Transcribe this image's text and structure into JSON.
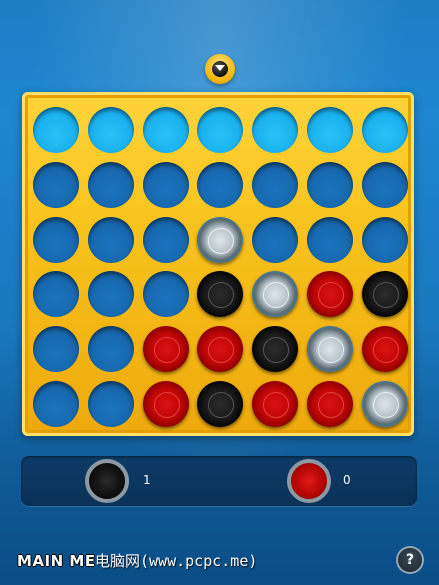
{
  "colors": {
    "background": "#1a78be",
    "board": "#f8c21c",
    "red_chip": "#c20606",
    "black_chip": "#1a1a1a",
    "empty_hole": "#1767ad",
    "score_bar": "#0a3157"
  },
  "drop_indicator": {
    "icon": "chevron-down-icon",
    "column": 4,
    "player": "black"
  },
  "board": {
    "columns": 7,
    "rows": 6,
    "grid": [
      [
        "empty",
        "empty",
        "empty",
        "empty",
        "empty",
        "empty",
        "empty"
      ],
      [
        "empty",
        "empty",
        "empty",
        "empty",
        "empty",
        "empty",
        "empty"
      ],
      [
        "empty",
        "empty",
        "empty",
        "win",
        "empty",
        "empty",
        "empty"
      ],
      [
        "empty",
        "empty",
        "empty",
        "black",
        "win",
        "red",
        "black"
      ],
      [
        "empty",
        "empty",
        "red",
        "red",
        "black",
        "win",
        "red"
      ],
      [
        "empty",
        "empty",
        "red",
        "black",
        "red",
        "red",
        "win"
      ]
    ]
  },
  "scores": {
    "player1": {
      "chip": "black",
      "value": "1"
    },
    "player2": {
      "chip": "red",
      "value": "0"
    }
  },
  "footer": {
    "main_menu_label": "MAIN ME",
    "watermark_text": "电脑网(www.pcpc.me)",
    "help_icon": "question-icon",
    "help_label": "?"
  }
}
